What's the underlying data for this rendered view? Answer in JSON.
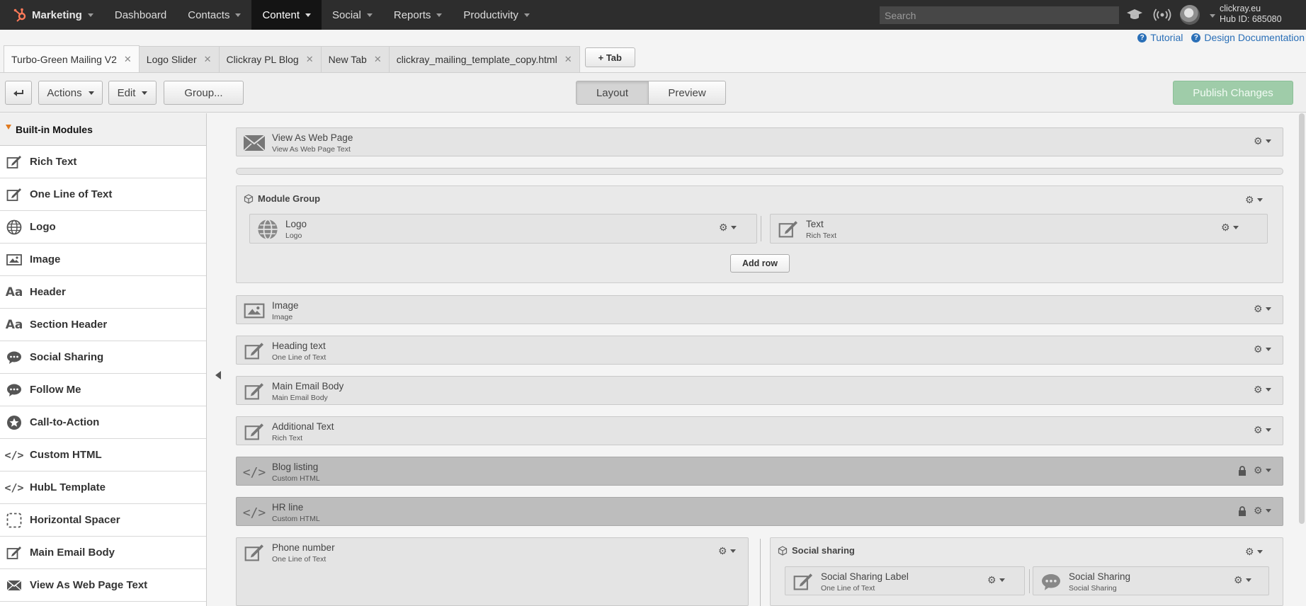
{
  "topnav": {
    "brand": "Marketing",
    "items": [
      "Dashboard",
      "Contacts",
      "Content",
      "Social",
      "Reports",
      "Productivity"
    ],
    "active": "Content",
    "search_placeholder": "Search",
    "account_name": "clickray.eu",
    "hub_id": "Hub ID: 685080"
  },
  "help": {
    "tutorial": "Tutorial",
    "docs": "Design Documentation"
  },
  "tabs": [
    "Turbo-Green Mailing V2",
    "Logo Slider",
    "Clickray PL Blog",
    "New Tab",
    "clickray_mailing_template_copy.html"
  ],
  "add_tab_label": "+ Tab",
  "toolbar": {
    "actions": "Actions",
    "edit": "Edit",
    "group": "Group...",
    "layout": "Layout",
    "preview": "Preview",
    "publish": "Publish Changes"
  },
  "sidebar": {
    "header": "Built-in Modules",
    "items": [
      "Rich Text",
      "One Line of Text",
      "Logo",
      "Image",
      "Header",
      "Section Header",
      "Social Sharing",
      "Follow Me",
      "Call-to-Action",
      "Custom HTML",
      "HubL Template",
      "Horizontal Spacer",
      "Main Email Body",
      "View As Web Page Text"
    ]
  },
  "modules": {
    "view_web": {
      "title": "View As Web Page",
      "sub": "View As Web Page Text"
    },
    "group_title": "Module Group",
    "logo": {
      "title": "Logo",
      "sub": "Logo"
    },
    "text": {
      "title": "Text",
      "sub": "Rich Text"
    },
    "add_row": "Add row",
    "image": {
      "title": "Image",
      "sub": "Image"
    },
    "heading": {
      "title": "Heading text",
      "sub": "One Line of Text"
    },
    "main_body": {
      "title": "Main Email Body",
      "sub": "Main Email Body"
    },
    "additional": {
      "title": "Additional Text",
      "sub": "Rich Text"
    },
    "blog": {
      "title": "Blog listing",
      "sub": "Custom HTML"
    },
    "hr": {
      "title": "HR line",
      "sub": "Custom HTML"
    },
    "phone": {
      "title": "Phone number",
      "sub": "One Line of Text"
    },
    "social_group_title": "Social sharing",
    "social_label": {
      "title": "Social Sharing Label",
      "sub": "One Line of Text"
    },
    "social_sharing": {
      "title": "Social Sharing",
      "sub": "Social Sharing"
    }
  },
  "colors": {
    "nav_bg": "#2d2d2d",
    "brand_orange": "#ff7a59",
    "publish_green": "#9fcca9",
    "link_blue": "#2a6fb7"
  }
}
